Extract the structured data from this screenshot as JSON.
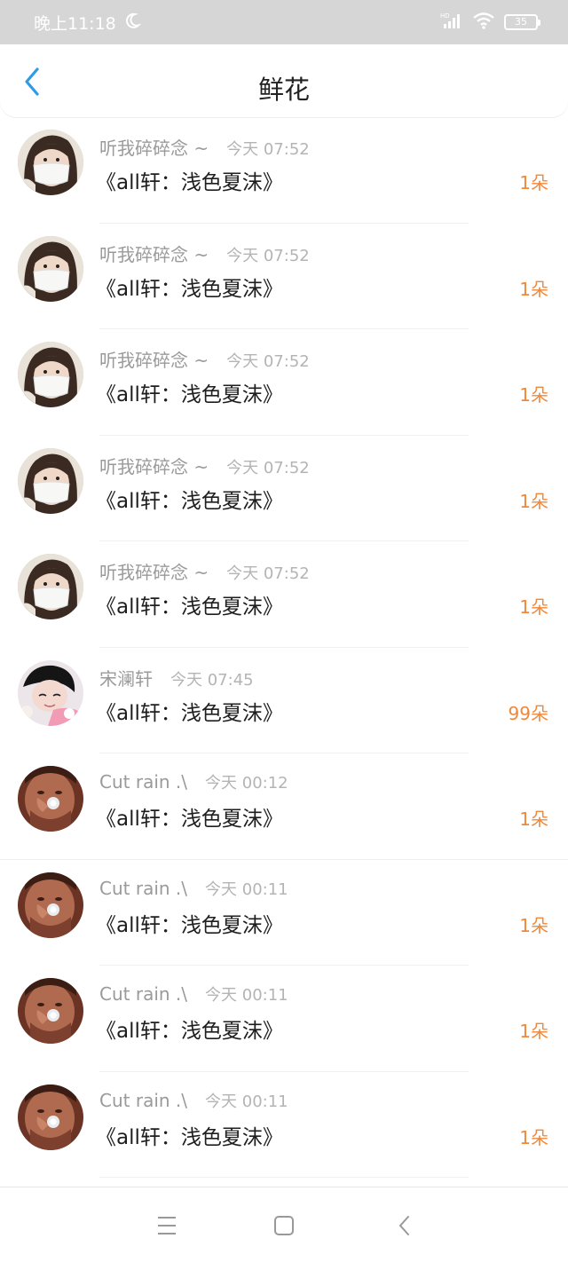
{
  "status_bar": {
    "time": "晚上11:18",
    "battery": "35",
    "icons": [
      "moon-icon",
      "signal-icon",
      "wifi-icon",
      "battery-icon"
    ]
  },
  "header": {
    "title": "鲜花",
    "back_icon": "chevron-left-icon",
    "accent_color": "#2f9ae5"
  },
  "records": [
    {
      "name": "听我碎碎念 ~",
      "time": "今天 07:52",
      "work": "《all轩：浅色夏沫》",
      "count": "1朵",
      "avatar": "girl-mask"
    },
    {
      "name": "听我碎碎念 ~",
      "time": "今天 07:52",
      "work": "《all轩：浅色夏沫》",
      "count": "1朵",
      "avatar": "girl-mask"
    },
    {
      "name": "听我碎碎念 ~",
      "time": "今天 07:52",
      "work": "《all轩：浅色夏沫》",
      "count": "1朵",
      "avatar": "girl-mask"
    },
    {
      "name": "听我碎碎念 ~",
      "time": "今天 07:52",
      "work": "《all轩：浅色夏沫》",
      "count": "1朵",
      "avatar": "girl-mask"
    },
    {
      "name": "听我碎碎念 ~",
      "time": "今天 07:52",
      "work": "《all轩：浅色夏沫》",
      "count": "1朵",
      "avatar": "girl-mask"
    },
    {
      "name": "宋澜轩",
      "time": "今天 07:45",
      "work": "《all轩：浅色夏沫》",
      "count": "99朵",
      "avatar": "boy-pillow"
    },
    {
      "name": "Cut rain .\\",
      "time": "今天 00:12",
      "work": "《all轩：浅色夏沫》",
      "count": "1朵",
      "avatar": "man-drinking"
    },
    {
      "name": "Cut rain .\\",
      "time": "今天 00:11",
      "work": "《all轩：浅色夏沫》",
      "count": "1朵",
      "avatar": "man-drinking"
    },
    {
      "name": "Cut rain .\\",
      "time": "今天 00:11",
      "work": "《all轩：浅色夏沫》",
      "count": "1朵",
      "avatar": "man-drinking"
    },
    {
      "name": "Cut rain .\\",
      "time": "今天 00:11",
      "work": "《all轩：浅色夏沫》",
      "count": "1朵",
      "avatar": "man-drinking"
    }
  ],
  "bottom_nav": {
    "items": [
      "menu-icon",
      "home-square-icon",
      "back-triangle-icon"
    ]
  },
  "colors": {
    "count": "#f0883a",
    "status_bar_bg": "#d6d6d6",
    "name": "#9a9a9a"
  }
}
